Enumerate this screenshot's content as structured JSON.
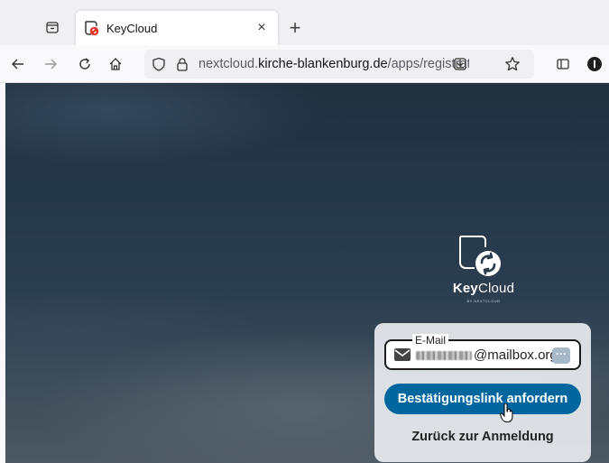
{
  "browser": {
    "tab": {
      "title": "KeyCloud",
      "close_icon": "×"
    },
    "new_tab_icon": "+",
    "url": {
      "prefix": "nextcloud.",
      "domain": "kirche-blankenburg.de",
      "path": "/apps/registrati"
    }
  },
  "logo": {
    "name_bold": "Key",
    "name_light": "Cloud",
    "sub": "BY NEXTCLOUD"
  },
  "form": {
    "email_label": "E-Mail",
    "email_value": "@mailbox.org",
    "password_manager_icon": "···",
    "submit_label": "Bestätigungslink anfordern",
    "back_label": "Zurück zur Anmeldung"
  },
  "colors": {
    "primary": "#00679e",
    "favicon_accent": "#e2382b"
  }
}
